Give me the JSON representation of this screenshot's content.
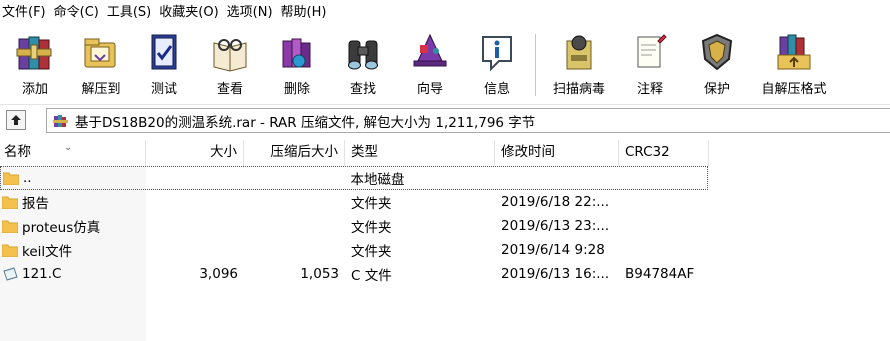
{
  "menu": {
    "file": "文件(F)",
    "commands": "命令(C)",
    "tools": "工具(S)",
    "favorites": "收藏夹(O)",
    "options": "选项(N)",
    "help": "帮助(H)"
  },
  "toolbar": {
    "add": "添加",
    "extract": "解压到",
    "test": "测试",
    "view": "查看",
    "delete": "删除",
    "find": "查找",
    "wizard": "向导",
    "info": "信息",
    "virus_scan": "扫描病毒",
    "comment": "注释",
    "protect": "保护",
    "sfx": "自解压格式"
  },
  "address": {
    "path": "基于DS18B20的测温系统.rar - RAR 压缩文件, 解包大小为 1,211,796 字节"
  },
  "columns": {
    "name": "名称",
    "size": "大小",
    "packed": "压缩后大小",
    "type": "类型",
    "modified": "修改时间",
    "crc": "CRC32"
  },
  "rows": [
    {
      "name": "..",
      "size": "",
      "packed": "",
      "type": "本地磁盘",
      "modified": "",
      "crc": "",
      "icon": "folder-icon"
    },
    {
      "name": "报告",
      "size": "",
      "packed": "",
      "type": "文件夹",
      "modified": "2019/6/18 22:...",
      "crc": "",
      "icon": "folder-icon"
    },
    {
      "name": "proteus仿真",
      "size": "",
      "packed": "",
      "type": "文件夹",
      "modified": "2019/6/13 23:...",
      "crc": "",
      "icon": "folder-icon"
    },
    {
      "name": "keil文件",
      "size": "",
      "packed": "",
      "type": "文件夹",
      "modified": "2019/6/14 9:28",
      "crc": "",
      "icon": "folder-icon"
    },
    {
      "name": "121.C",
      "size": "3,096",
      "packed": "1,053",
      "type": "C 文件",
      "modified": "2019/6/13 16:...",
      "crc": "B94784AF",
      "icon": "c-file-icon"
    }
  ],
  "colors": {
    "folder": "#f2c14e",
    "folder_dark": "#d9a233",
    "rar_purple": "#6b3fa0",
    "rar_teal": "#2d8fa8"
  }
}
